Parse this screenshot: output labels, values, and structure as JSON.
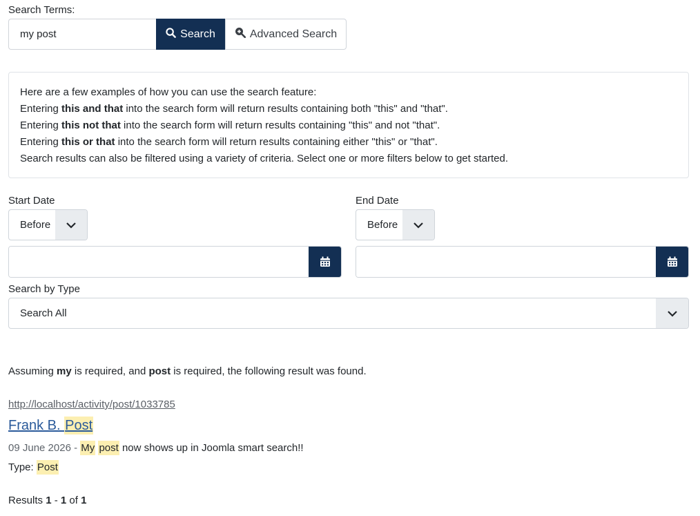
{
  "search": {
    "label": "Search Terms:",
    "value": "my post",
    "search_button": "Search",
    "advanced_button": "Advanced Search"
  },
  "info": {
    "intro": "Here are a few examples of how you can use the search feature:",
    "lines": [
      {
        "pre": "Entering ",
        "bold": "this and that",
        "post": " into the search form will return results containing both \"this\" and \"that\"."
      },
      {
        "pre": "Entering ",
        "bold": "this not that",
        "post": " into the search form will return results containing \"this\" and not \"that\"."
      },
      {
        "pre": "Entering ",
        "bold": "this or that",
        "post": " into the search form will return results containing either \"this\" or \"that\"."
      }
    ],
    "outro": "Search results can also be filtered using a variety of criteria. Select one or more filters below to get started."
  },
  "filters": {
    "start_label": "Start Date",
    "start_mode": "Before",
    "start_value": "",
    "end_label": "End Date",
    "end_mode": "Before",
    "end_value": "",
    "type_label": "Search by Type",
    "type_value": "Search All"
  },
  "summary": {
    "p1": "Assuming ",
    "t1": "my",
    "p2": " is required, and ",
    "t2": "post",
    "p3": " is required, the following result was found."
  },
  "result": {
    "url": "http://localhost/activity/post/1033785",
    "title_a": "Frank B. ",
    "title_b": "Post",
    "date": "09 June 2026",
    "dash": " - ",
    "desc_a": "My",
    "desc_sp": " ",
    "desc_b": "post",
    "desc_c": " now shows up in Joomla smart search!!",
    "type_label": "Type: ",
    "type_value": "Post"
  },
  "pagination": {
    "prefix": "Results ",
    "from": "1",
    "sep": " - ",
    "to": "1",
    "of": " of ",
    "total": "1"
  },
  "colors": {
    "accent": "#132f53",
    "highlight": "#fcefb1",
    "link": "#2a5a9a"
  }
}
